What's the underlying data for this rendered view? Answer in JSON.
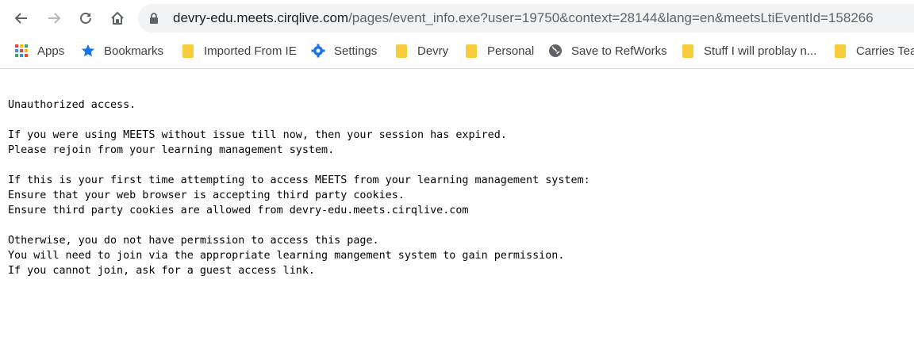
{
  "browser": {
    "url_host": "devry-edu.meets.cirqlive.com",
    "url_path": "/pages/event_info.exe?user=19750&context=28144&lang=en&meetsLtiEventId=158266"
  },
  "bookmarks": [
    {
      "label": "Apps",
      "icon": "apps-grid-icon"
    },
    {
      "label": "Bookmarks",
      "icon": "star-icon"
    },
    {
      "label": "Imported From IE",
      "icon": "folder-icon"
    },
    {
      "label": "Settings",
      "icon": "gear-icon"
    },
    {
      "label": "Devry",
      "icon": "folder-icon"
    },
    {
      "label": "Personal",
      "icon": "folder-icon"
    },
    {
      "label": "Save to RefWorks",
      "icon": "globe-icon"
    },
    {
      "label": "Stuff I will problay n...",
      "icon": "folder-icon"
    },
    {
      "label": "Carries Teac",
      "icon": "folder-icon"
    }
  ],
  "page": {
    "p1": [
      "Unauthorized access."
    ],
    "p2": [
      "If you were using MEETS without issue till now, then your session has expired.",
      "Please rejoin from your learning management system."
    ],
    "p3": [
      "If this is your first time attempting to access MEETS from your learning management system:",
      "Ensure that your web browser is accepting third party cookies.",
      "Ensure third party cookies are allowed from devry-edu.meets.cirqlive.com"
    ],
    "p4": [
      "Otherwise, you do not have permission to access this page.",
      "You will need to join via the appropriate learning mangement system to gain permission.",
      "If you cannot join, ask for a guest access link."
    ]
  }
}
